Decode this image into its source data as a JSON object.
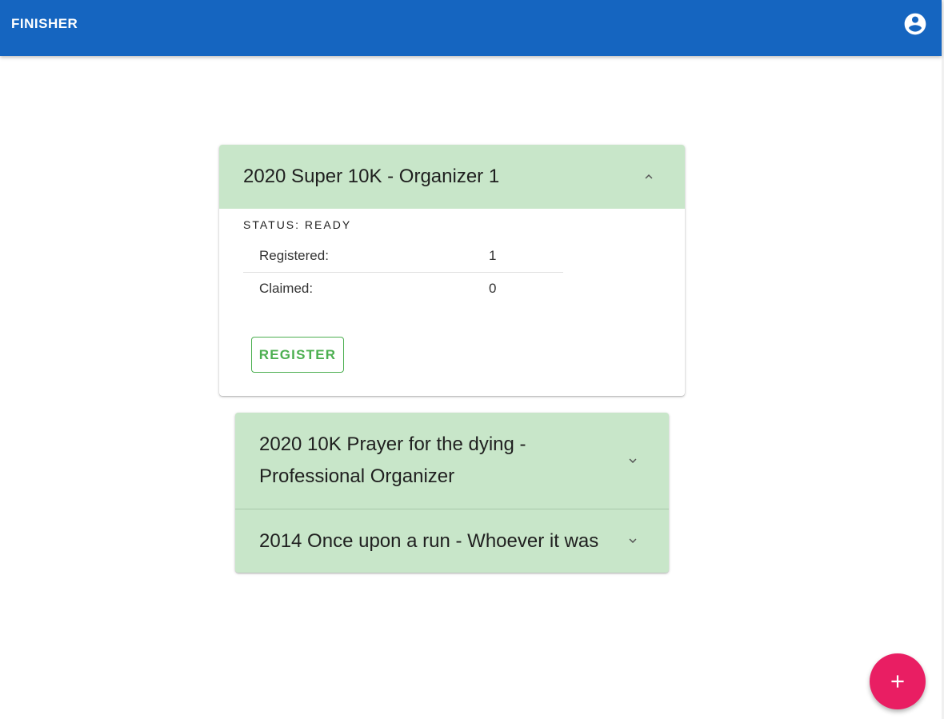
{
  "app": {
    "title": "FINISHER",
    "account_icon": "account-circle-icon"
  },
  "colors": {
    "appbar": "#1565c0",
    "panel": "#c8e6c9",
    "register": "#4caf50",
    "fab": "#e91e63"
  },
  "events": {
    "expanded": {
      "title": "2020 Super 10K - Organizer 1",
      "status": "STATUS: READY",
      "rows": [
        {
          "label": "Registered:",
          "value": "1"
        },
        {
          "label": "Claimed:",
          "value": "0"
        }
      ],
      "register_label": "REGISTER",
      "toggle_icon": "chevron-up-icon"
    },
    "collapsed": [
      {
        "title_line1": "2020 10K Prayer for the dying -",
        "title_line2": "Professional Organizer",
        "toggle_icon": "chevron-down-icon"
      },
      {
        "title": "2014 Once upon a run - Whoever it was",
        "toggle_icon": "chevron-down-icon"
      }
    ]
  },
  "fab": {
    "icon": "plus-icon"
  }
}
